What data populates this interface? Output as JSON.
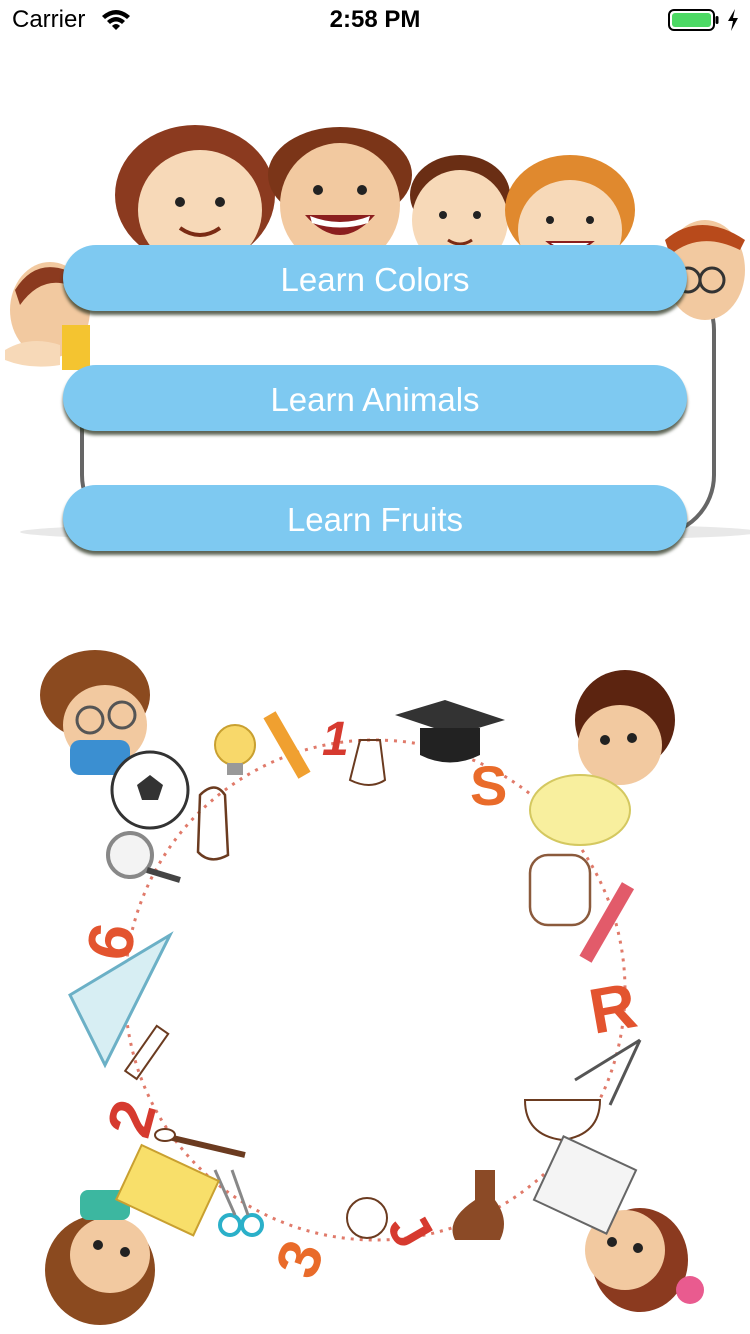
{
  "status_bar": {
    "carrier": "Carrier",
    "time": "2:58 PM",
    "icons": [
      "wifi-icon",
      "battery-icon",
      "charging-icon"
    ],
    "battery_color": "#4cd964"
  },
  "menu": {
    "buttons": [
      {
        "label": "Learn Colors"
      },
      {
        "label": "Learn Animals"
      },
      {
        "label": "Learn Fruits"
      }
    ],
    "button_color": "#7ec9f1",
    "text_color": "#ffffff"
  },
  "illustrations": {
    "top": "kids-peeking-over-board",
    "bottom": "kids-circle-with-school-supplies",
    "bottom_glyphs": [
      "1",
      "S",
      "6",
      "R",
      "2",
      "3",
      "J"
    ]
  }
}
